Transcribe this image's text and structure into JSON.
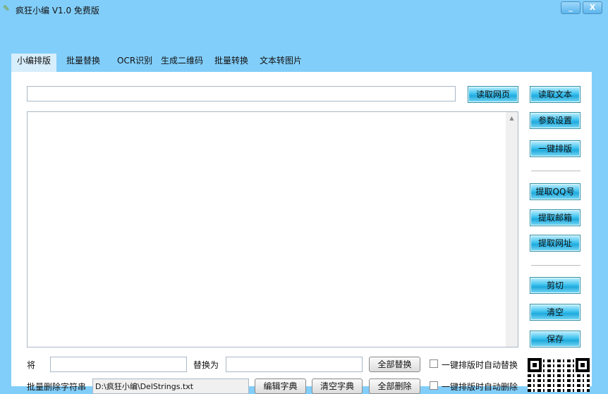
{
  "window": {
    "title": "疯狂小编 V1.0 免费版",
    "minimize": "_",
    "close": "X"
  },
  "tabs": [
    "小编排版",
    "批量替换",
    "OCR识别",
    "生成二维码",
    "批量转换",
    "文本转图片"
  ],
  "url_input": {
    "value": ""
  },
  "buttons": {
    "read_web": "读取网页",
    "read_text": "读取文本",
    "settings": "参数设置",
    "one_key": "一键排版",
    "extract_qq": "提取QQ号",
    "extract_email": "提取邮箱",
    "extract_url": "提取网址",
    "cut": "剪切",
    "clear": "清空",
    "save": "保存"
  },
  "replace": {
    "from_label": "将",
    "to_label": "替换为",
    "from_value": "",
    "to_value": "",
    "replace_all": "全部替换",
    "auto_label": "一键排版时自动替换"
  },
  "delete": {
    "label": "批量删除字符串",
    "path": "D:\\疯狂小编\\DelStrings.txt",
    "edit": "编辑字典",
    "clear": "清空字典",
    "delete_all": "全部删除",
    "auto_label": "一键排版时自动删除"
  }
}
